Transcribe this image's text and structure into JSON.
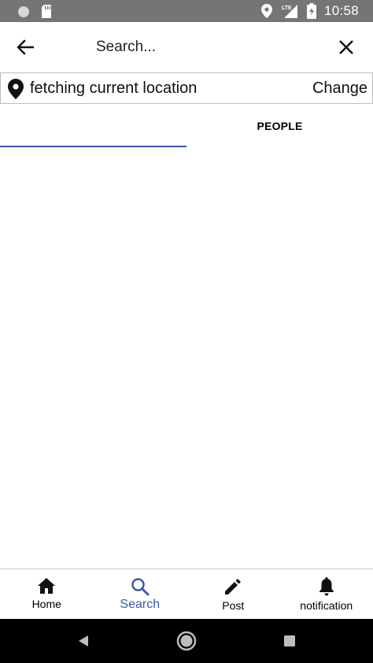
{
  "status_bar": {
    "time": "10:58",
    "network": "LTE",
    "icons": [
      "circle-icon",
      "sd-card-icon",
      "location-icon",
      "signal-icon",
      "battery-charging-icon"
    ]
  },
  "app_bar": {
    "search_placeholder": "Search...",
    "back_icon": "arrow-back-icon",
    "close_icon": "close-icon"
  },
  "location": {
    "text": "fetching current location",
    "change_label": "Change",
    "icon": "pin-icon"
  },
  "tabs": [
    {
      "label": "",
      "selected": true
    },
    {
      "label": "PEOPLE",
      "selected": false
    }
  ],
  "bottom_nav": [
    {
      "label": "Home",
      "icon": "home-icon",
      "active": false
    },
    {
      "label": "Search",
      "icon": "search-icon",
      "active": true
    },
    {
      "label": "Post",
      "icon": "pencil-icon",
      "active": false
    },
    {
      "label": "notification",
      "icon": "bell-icon",
      "active": false
    }
  ],
  "colors": {
    "accent": "#3b5aa6",
    "status_bar": "#757575",
    "system_nav": "#000000"
  }
}
